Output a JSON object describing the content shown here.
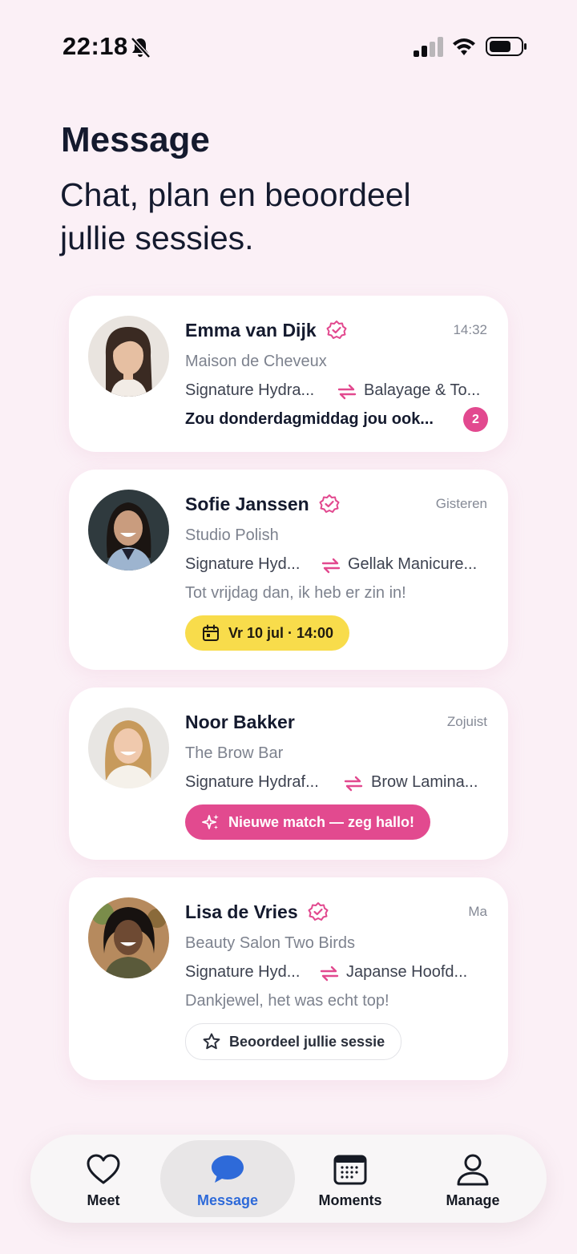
{
  "status_bar": {
    "time": "22:18"
  },
  "header": {
    "title": "Message",
    "subtitle": "Chat, plan en beoordeel jullie sessies."
  },
  "conversations": [
    {
      "name": "Emma van Dijk",
      "verified": true,
      "time": "14:32",
      "salon": "Maison de Cheveux",
      "service_offered": "Signature Hydra...",
      "service_wanted": "Balayage & To...",
      "preview": "Zou donderdagmiddag jou ook...",
      "unread_count": "2"
    },
    {
      "name": "Sofie Janssen",
      "verified": true,
      "time": "Gisteren",
      "salon": "Studio Polish",
      "service_offered": "Signature Hyd...",
      "service_wanted": "Gellak Manicure...",
      "preview": "Tot vrijdag dan, ik heb er zin in!",
      "pill_label": "Vr 10 jul · 14:00",
      "pill_icon": "calendar-icon"
    },
    {
      "name": "Noor Bakker",
      "verified": false,
      "time": "Zojuist",
      "salon": "The Brow Bar",
      "service_offered": "Signature Hydraf...",
      "service_wanted": "Brow Lamina...",
      "pill_label": "Nieuwe match — zeg hallo!",
      "pill_icon": "sparkles-icon"
    },
    {
      "name": "Lisa de Vries",
      "verified": true,
      "time": "Ma",
      "salon": "Beauty Salon Two Birds",
      "service_offered": "Signature Hyd...",
      "service_wanted": "Japanse Hoofd...",
      "preview": "Dankjewel, het was echt top!",
      "pill_label": "Beoordeel jullie sessie",
      "pill_icon": "star-icon"
    }
  ],
  "bottom_nav": [
    {
      "label": "Meet",
      "icon": "heart-icon",
      "active": false
    },
    {
      "label": "Message",
      "icon": "chat-bubble-icon",
      "active": true
    },
    {
      "label": "Moments",
      "icon": "calendar-grid-icon",
      "active": false
    },
    {
      "label": "Manage",
      "icon": "person-icon",
      "active": false
    }
  ],
  "colors": {
    "background": "#fbf0f6",
    "accent_pink": "#e24a8f",
    "date_yellow": "#f8dc4b",
    "active_blue": "#2e6ad9",
    "text_dark": "#141a2e",
    "text_muted": "#7d828e"
  }
}
